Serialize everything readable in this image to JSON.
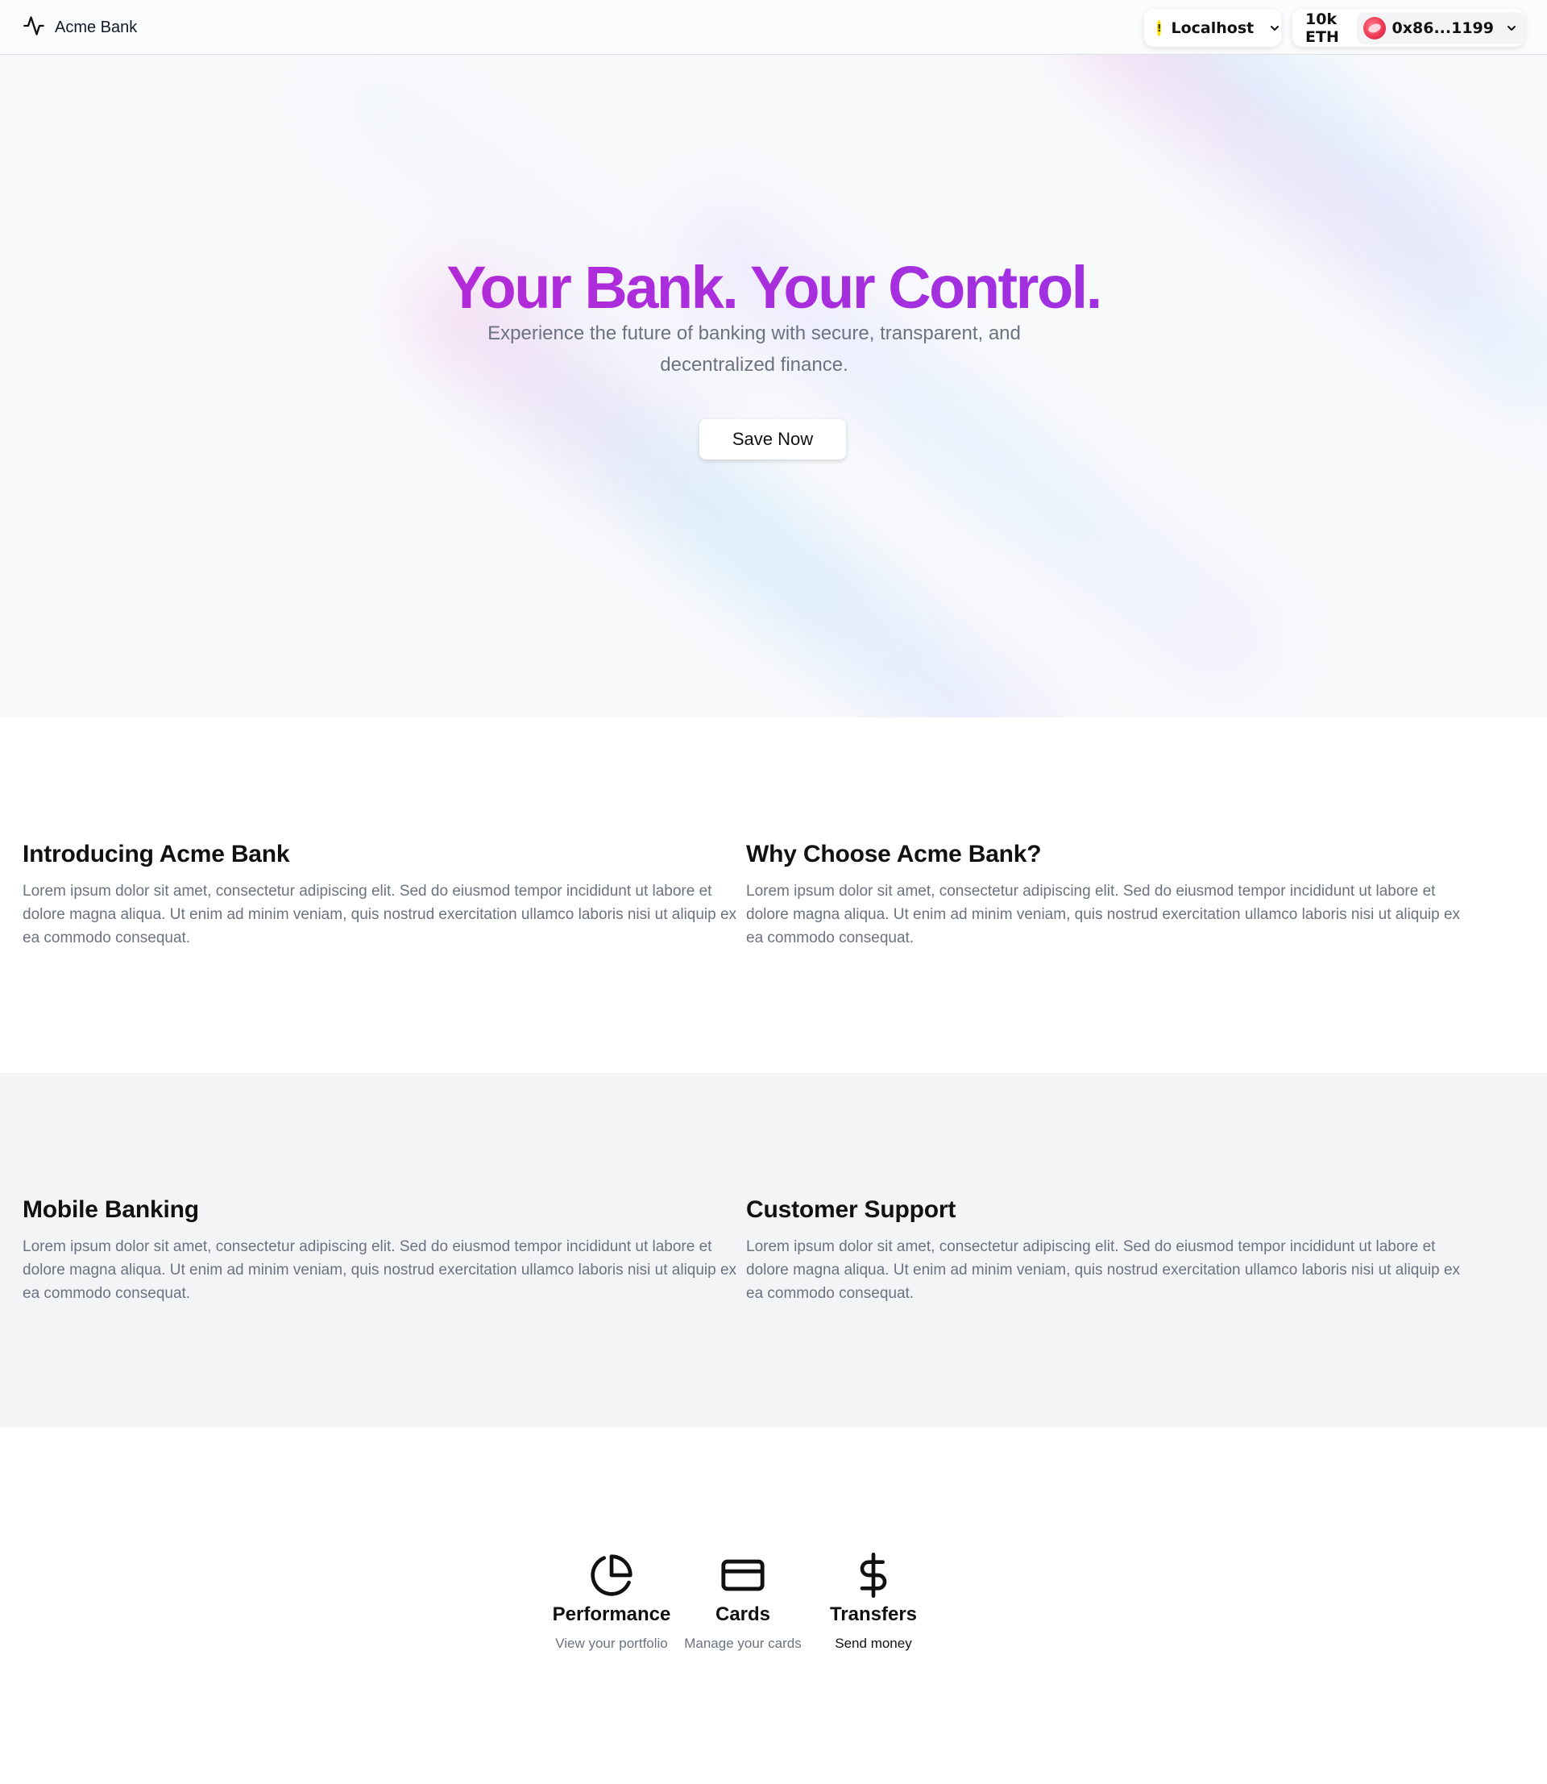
{
  "header": {
    "brand": "Acme Bank",
    "network": "Localhost",
    "network_icon": "!",
    "balance": "10k ETH",
    "address": "0x86...1199"
  },
  "hero": {
    "title": "Your Bank. Your Control.",
    "subtitle": "Experience the future of banking with secure, transparent, and decentralized finance.",
    "cta": "Save Now"
  },
  "info": [
    {
      "title": "Introducing Acme Bank",
      "body": "Lorem ipsum dolor sit amet, consectetur adipiscing elit. Sed do eiusmod tempor incididunt ut labore et dolore magna aliqua. Ut enim ad minim veniam, quis nostrud exercitation ullamco laboris nisi ut aliquip ex ea commodo consequat."
    },
    {
      "title": "Why Choose Acme Bank?",
      "body": "Lorem ipsum dolor sit amet, consectetur adipiscing elit. Sed do eiusmod tempor incididunt ut labore et dolore magna aliqua. Ut enim ad minim veniam, quis nostrud exercitation ullamco laboris nisi ut aliquip ex ea commodo consequat."
    },
    {
      "title": "Mobile Banking",
      "body": "Lorem ipsum dolor sit amet, consectetur adipiscing elit. Sed do eiusmod tempor incididunt ut labore et dolore magna aliqua. Ut enim ad minim veniam, quis nostrud exercitation ullamco laboris nisi ut aliquip ex ea commodo consequat."
    },
    {
      "title": "Customer Support",
      "body": "Lorem ipsum dolor sit amet, consectetur adipiscing elit. Sed do eiusmod tempor incididunt ut labore et dolore magna aliqua. Ut enim ad minim veniam, quis nostrud exercitation ullamco laboris nisi ut aliquip ex ea commodo consequat."
    }
  ],
  "features": [
    {
      "icon": "pie-chart-icon",
      "title": "Performance",
      "desc": "View your portfolio"
    },
    {
      "icon": "credit-card-icon",
      "title": "Cards",
      "desc": "Manage your cards"
    },
    {
      "icon": "dollar-icon",
      "title": "Transfers",
      "desc": "Send money"
    }
  ],
  "colors": {
    "title_gradient_start": "#c026d3",
    "title_gradient_end": "#9333ea",
    "muted_text": "#6b7280",
    "alt_section_bg": "#f3f4f6"
  }
}
